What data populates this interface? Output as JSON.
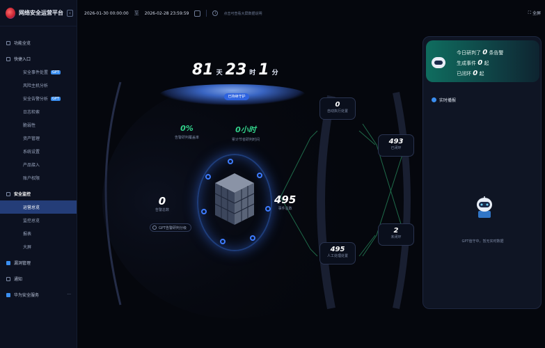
{
  "app": {
    "title": "网络安全运营平台"
  },
  "sidebar": {
    "items": [
      {
        "label": "功能全览",
        "type": "group"
      },
      {
        "label": "快捷入口",
        "type": "group"
      },
      {
        "label": "安全事件处置",
        "type": "item",
        "tag": "GPT"
      },
      {
        "label": "风险主机分析",
        "type": "item"
      },
      {
        "label": "安全告警分析",
        "type": "item",
        "tag": "GPT"
      },
      {
        "label": "日志检索",
        "type": "item"
      },
      {
        "label": "脆弱性",
        "type": "item"
      },
      {
        "label": "资产管理",
        "type": "item"
      },
      {
        "label": "系统设置",
        "type": "item"
      },
      {
        "label": "产品接入",
        "type": "item"
      },
      {
        "label": "账户权限",
        "type": "item"
      },
      {
        "label": "安全监控",
        "type": "group-strong"
      },
      {
        "label": "运营总览",
        "type": "item",
        "active": true
      },
      {
        "label": "监控总览",
        "type": "item"
      },
      {
        "label": "报表",
        "type": "item"
      },
      {
        "label": "大屏",
        "type": "item"
      },
      {
        "label": "漏洞管理",
        "type": "group-blue"
      },
      {
        "label": "通知",
        "type": "group"
      },
      {
        "label": "华为安全服务",
        "type": "group-blue",
        "dots": true
      }
    ]
  },
  "topbar": {
    "start_date": "2026-01-30 00:00:00",
    "separator": "至",
    "end_date": "2026-02-28 23:59:59",
    "hint": "点击可查看大屏数据说明",
    "fullscreen_label": "全屏"
  },
  "stage": {
    "timer": {
      "days": "81",
      "days_unit": "天",
      "hours": "23",
      "hours_unit": "时",
      "minutes": "1",
      "minutes_unit": "分"
    },
    "running_label": "已持续守护",
    "kpi_left": {
      "value": "0%",
      "label": "告警研判覆盖率"
    },
    "kpi_right": {
      "value": "0小时",
      "label": "累计节省研判时间"
    },
    "left_num": {
      "value": "0",
      "label": "告警总数"
    },
    "gpt_chip": "GPT告警研判分级",
    "mid_num": {
      "value": "495",
      "label": "事件总数"
    },
    "flow": {
      "top": {
        "value": "0",
        "label": "自动执行处置"
      },
      "bottom": {
        "value": "495",
        "label": "人工处理处置"
      },
      "right_top": {
        "value": "493",
        "label": "已闭环"
      },
      "right_bottom": {
        "value": "2",
        "label": "未闭环"
      }
    }
  },
  "panel": {
    "line1_prefix": "今日研判了",
    "line1_value": "0",
    "line1_suffix": "条告警",
    "line2_prefix": "生成事件",
    "line2_value": "0",
    "line2_suffix": "起",
    "line3_prefix": "已闭环",
    "line3_value": "0",
    "line3_suffix": "起",
    "section_title": "实时播报",
    "empty_text": "GPT值守中，暂无实时数据"
  },
  "colors": {
    "accent": "#3a8ef0",
    "green": "#32d18a",
    "active_nav": "#243d78"
  }
}
